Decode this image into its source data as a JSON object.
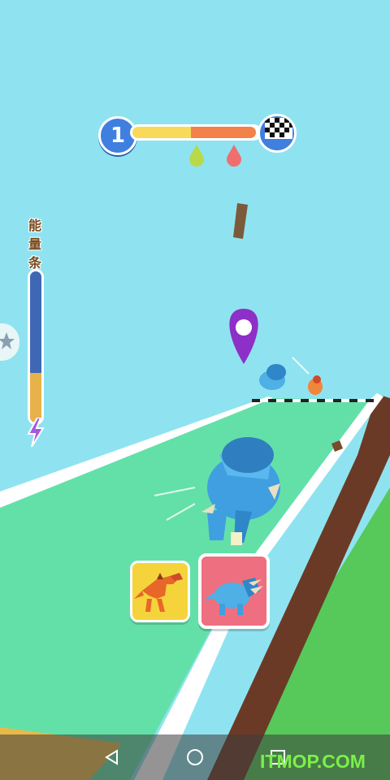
{
  "hud": {
    "level": "1",
    "progress": {
      "yellow_fraction": 0.46,
      "orange_fraction": 0.51
    },
    "drops": [
      {
        "name": "green-drop-icon",
        "color": "#b8d94a"
      },
      {
        "name": "red-drop-icon",
        "color": "#ef6f6f"
      }
    ],
    "finish_icon": "checkered-flag-icon"
  },
  "energy": {
    "label_chars": [
      "能",
      "量",
      "条"
    ],
    "level_fraction": 0.33,
    "icon": "lightning-bolt-icon"
  },
  "cards": [
    {
      "name": "raptor-card",
      "color": "#f4d43a",
      "selected": false
    },
    {
      "name": "triceratops-card",
      "color": "#ee6f7f",
      "selected": true
    }
  ],
  "colors": {
    "sky": "#8fe3f0",
    "track": "#63e0a8",
    "track_edge": "#ffffff",
    "cliff": "#6b3a26",
    "grass": "#56c95a",
    "marker": "#8e2fc8"
  },
  "nav": {
    "back_icon": "back-triangle-icon",
    "home_icon": "home-circle-icon",
    "recent_icon": "recent-square-icon"
  },
  "watermark": "ITMOP.COM"
}
